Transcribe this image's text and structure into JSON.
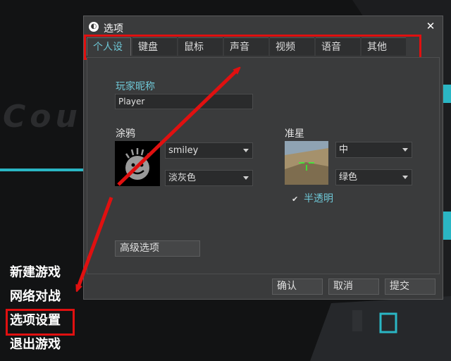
{
  "background": {
    "logo_text": "Cou"
  },
  "main_menu": {
    "items": [
      {
        "label": "新建游戏"
      },
      {
        "label": "网络对战"
      },
      {
        "label": "选项设置"
      },
      {
        "label": "退出游戏"
      }
    ]
  },
  "dialog": {
    "title": "选项",
    "close_glyph": "✕",
    "tabs": [
      "个人设置",
      "键盘",
      "鼠标",
      "声音",
      "视频",
      "语音",
      "其他"
    ],
    "active_tab": "个人设置",
    "nickname": {
      "label": "玩家昵称",
      "value": "Player"
    },
    "spray": {
      "label": "涂鸦",
      "image_select": "smiley",
      "color_select": "淡灰色"
    },
    "crosshair": {
      "label": "准星",
      "size_select": "中",
      "color_select": "绿色",
      "translucent_label": "半透明",
      "translucent_checked": true
    },
    "advanced_button": "高级选项",
    "buttons": {
      "ok": "确认",
      "cancel": "取消",
      "submit": "提交"
    }
  },
  "colors": {
    "highlight": "#e01010",
    "accent": "#6ec7d6",
    "cyan_line": "#2ab6c4"
  }
}
